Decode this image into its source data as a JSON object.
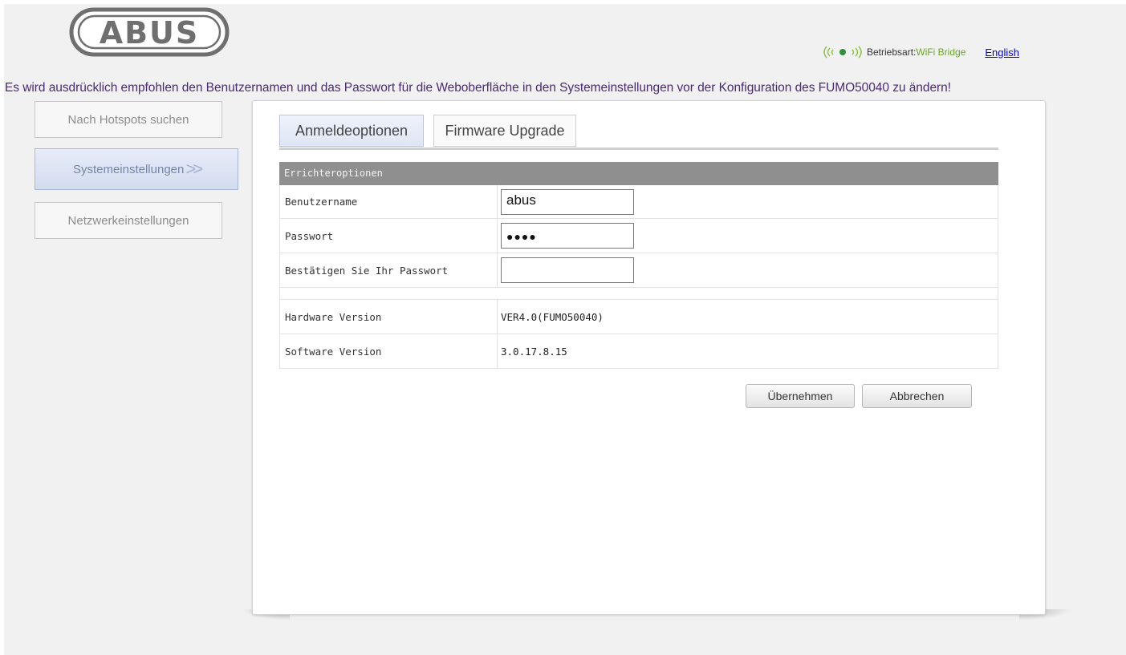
{
  "header": {
    "logo_text": "ABUS",
    "mode_label": "Betriebsart:",
    "mode_value": "WiFi Bridge",
    "language_link": "English"
  },
  "warning": "Es wird ausdrücklich empfohlen den Benutzernamen und das Passwort für die Weboberfläche in den Systemeinstellungen vor der Konfiguration des FUMO50040 zu ändern!",
  "sidebar": {
    "items": [
      {
        "label": "Nach Hotspots suchen",
        "active": false
      },
      {
        "label": "Systemeinstellungen",
        "active": true,
        "suffix": ">>"
      },
      {
        "label": "Netzwerkeinstellungen",
        "active": false
      }
    ]
  },
  "tabs": [
    {
      "label": "Anmeldeoptionen",
      "active": true
    },
    {
      "label": "Firmware Upgrade",
      "active": false
    }
  ],
  "section": {
    "title": "Errichteroptionen",
    "username_label": "Benutzername",
    "username_value": "abus",
    "password_label": "Passwort",
    "password_value": "●●●●",
    "confirm_label": "Bestätigen Sie Ihr Passwort",
    "confirm_value": "",
    "hardware_label": "Hardware Version",
    "hardware_value": "VER4.0(FUMO50040)",
    "software_label": "Software Version",
    "software_value": "3.0.17.8.15"
  },
  "actions": {
    "apply": "Übernehmen",
    "cancel": "Abbrechen"
  },
  "colors": {
    "warning_text": "#4b2a72",
    "mode_value": "#6aa527",
    "section_header": "#8f8f8f",
    "active_tab": "#dfe6f4"
  }
}
